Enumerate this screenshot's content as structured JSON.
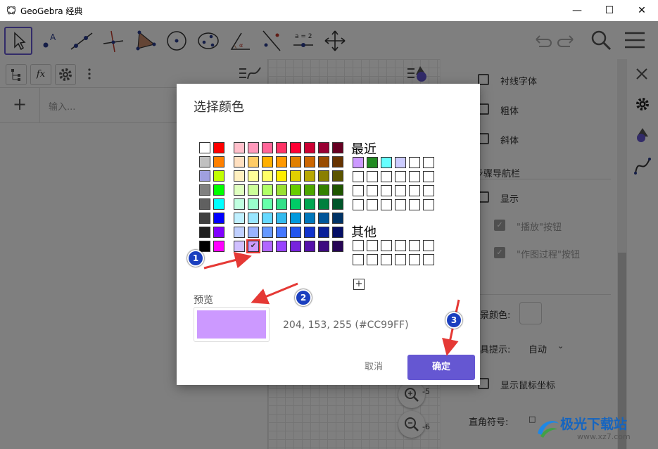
{
  "window": {
    "title": "GeoGebra 经典",
    "minimize": "—",
    "maximize": "☐",
    "close": "✕"
  },
  "toolbar": {
    "tools": [
      "move-tool",
      "point-tool",
      "line-tool",
      "perpendicular-tool",
      "polygon-tool",
      "circle-tool",
      "conic-tool",
      "angle-tool",
      "reflect-tool",
      "slider-tool",
      "move-view-tool"
    ],
    "slider_label": "a = 2"
  },
  "algebra": {
    "fx_label": "fx",
    "add": "+",
    "input_placeholder": "输入..."
  },
  "properties": {
    "serif_font": "衬线字体",
    "bold": "粗体",
    "italic": "斜体",
    "nav_bar_section": "步骤导航栏",
    "show": "显示",
    "play_button": "\"播放\"按钮",
    "construction_button": "\"作图过程\"按钮",
    "bg_color_label": "景颜色:",
    "tooltips_label": "具提示:",
    "tooltips_value": "自动",
    "show_mouse_coords": "显示鼠标坐标",
    "right_angle_label": "直角符号:",
    "right_angle_value": "□"
  },
  "graphics": {
    "zoom_labels": [
      "-5",
      "-6"
    ]
  },
  "dialog": {
    "title": "选择颜色",
    "recent_label": "最近",
    "other_label": "其他",
    "preview_label": "预览",
    "color_value": "204, 153, 255 (#CC99FF)",
    "preview_color": "#CC99FF",
    "cancel": "取消",
    "ok": "确定",
    "plus": "+",
    "recent_colors": [
      "#CC99FF",
      "#228B22",
      "#66FFFF",
      "#CCCCFF"
    ],
    "palette_left": [
      [
        "#FFFFFF",
        "#FF0000"
      ],
      [
        "#C0C0C0",
        "#FF8000"
      ],
      [
        "#A0A0E0",
        "#C0FF00"
      ],
      [
        "#808080",
        "#00FF00"
      ],
      [
        "#606060",
        "#00FFFF"
      ],
      [
        "#404040",
        "#0000FF"
      ],
      [
        "#202020",
        "#8000FF"
      ],
      [
        "#000000",
        "#FF00FF"
      ]
    ],
    "palette_main": [
      [
        "#FFC0CB",
        "#FF99BB",
        "#FF6699",
        "#FF3366",
        "#FF0033",
        "#CC0033",
        "#990033",
        "#660022"
      ],
      [
        "#FFE0C0",
        "#FFCC66",
        "#FFB000",
        "#FF9900",
        "#E08000",
        "#CC6600",
        "#994C00",
        "#663300"
      ],
      [
        "#FFF0C0",
        "#FFFF99",
        "#FFFF66",
        "#FFEE00",
        "#E0D000",
        "#B8A800",
        "#8A7F00",
        "#5C5500"
      ],
      [
        "#E0FFC0",
        "#CCFF99",
        "#B0FF66",
        "#99E033",
        "#66CC00",
        "#4CA600",
        "#338000",
        "#1F5500"
      ],
      [
        "#C0FFE0",
        "#99FFCC",
        "#66FFAA",
        "#33E088",
        "#00CC66",
        "#00A652",
        "#00803E",
        "#00552A"
      ],
      [
        "#C0F0FF",
        "#99E6FF",
        "#66D9FF",
        "#33BBEE",
        "#0099DD",
        "#0077BB",
        "#005599",
        "#003366"
      ],
      [
        "#C0D0FF",
        "#99B3FF",
        "#6699FF",
        "#4477FF",
        "#2255EE",
        "#1133CC",
        "#0A1F99",
        "#050F66"
      ],
      [
        "#D0C0FF",
        "#CC99FF",
        "#B266FF",
        "#9944FF",
        "#7722DD",
        "#5511AA",
        "#3D0A80",
        "#260555"
      ]
    ]
  },
  "annotations": {
    "badge1": "1",
    "badge2": "2",
    "badge3": "3"
  },
  "watermark": {
    "brand": "极光下载站",
    "url": "www.xz7.com"
  }
}
